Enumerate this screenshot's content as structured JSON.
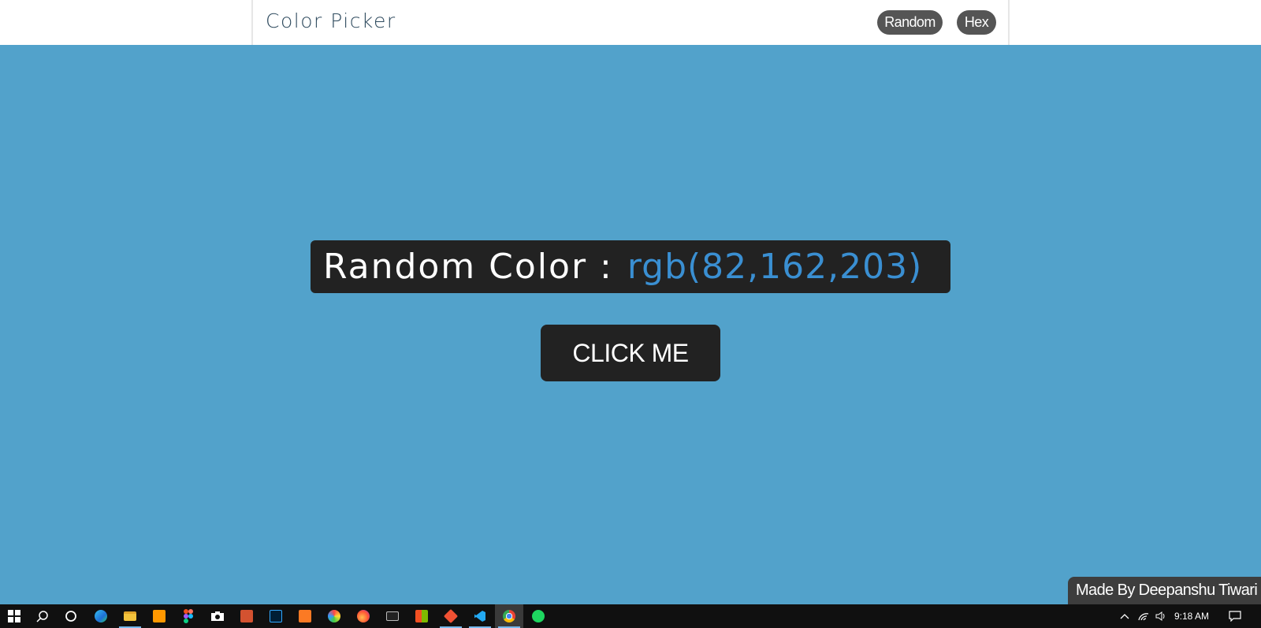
{
  "header": {
    "brand": "Color Picker",
    "buttons": [
      {
        "label": "Random"
      },
      {
        "label": "Hex"
      }
    ]
  },
  "main": {
    "label": "Random Color :",
    "value": "rgb(82,162,203)",
    "value_color": "#3a8fd2",
    "background_color": "#52a2cb",
    "button_label": "CLICK ME"
  },
  "credit": "Made By Deepanshu Tiwari",
  "taskbar": {
    "apps": [
      {
        "name": "start-icon"
      },
      {
        "name": "search-icon"
      },
      {
        "name": "cortana-icon"
      },
      {
        "name": "edge-icon"
      },
      {
        "name": "file-explorer-icon"
      },
      {
        "name": "sublime-text-icon"
      },
      {
        "name": "figma-icon"
      },
      {
        "name": "camera-icon"
      },
      {
        "name": "powerpoint-icon"
      },
      {
        "name": "photoshop-icon"
      },
      {
        "name": "xampp-icon"
      },
      {
        "name": "paint-icon"
      },
      {
        "name": "firefox-icon"
      },
      {
        "name": "terminal-icon"
      },
      {
        "name": "store-icon"
      },
      {
        "name": "git-icon"
      },
      {
        "name": "vscode-icon"
      },
      {
        "name": "chrome-icon"
      },
      {
        "name": "spotify-icon"
      }
    ],
    "time": "9:18 AM"
  }
}
